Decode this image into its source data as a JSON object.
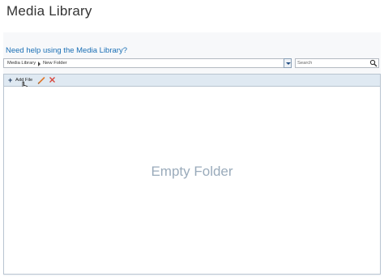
{
  "page": {
    "title": "Media Library"
  },
  "panel": {
    "help_link": "Need help using the Media Library?",
    "breadcrumb": {
      "items": [
        "Media Library",
        "New Folder"
      ]
    },
    "search": {
      "placeholder": "Search"
    },
    "toolbar": {
      "add_file_label": "Add File"
    },
    "content": {
      "empty_text": "Empty Folder"
    }
  },
  "icons": {
    "breadcrumb_separator": "triangle-right-icon",
    "dropdown": "chevron-down-icon",
    "search": "magnifier-icon",
    "add": "plus-icon",
    "rename": "pencil-icon",
    "delete": "x-icon",
    "pointer": "hand-cursor-icon"
  },
  "colors": {
    "link": "#1a6fb5",
    "toolbar_bg": "#dfe9f2",
    "empty_text": "#9aabbb",
    "pencil": "#e0772a",
    "delete": "#d9443a"
  }
}
